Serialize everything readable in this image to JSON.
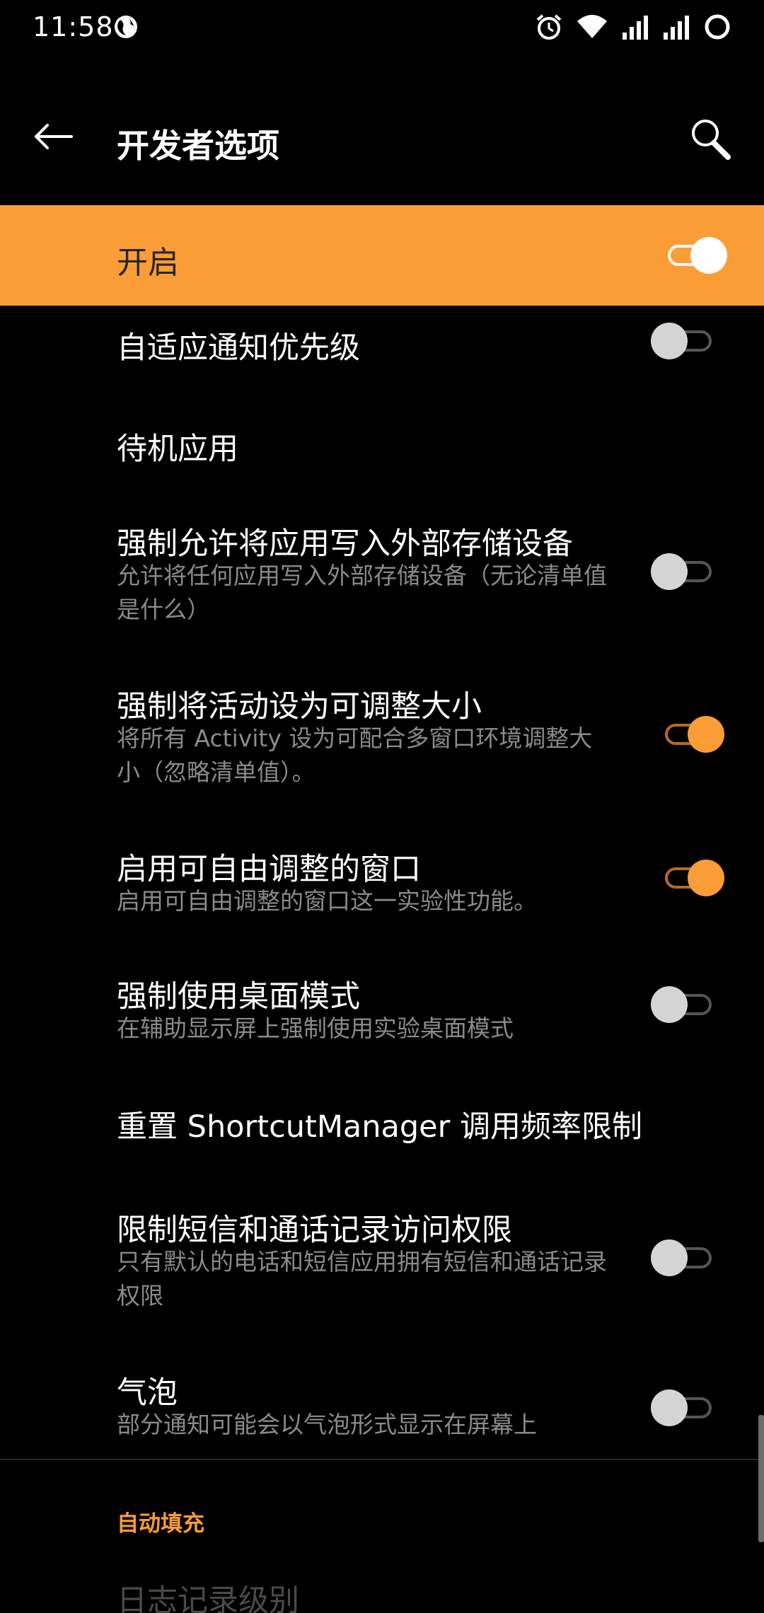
{
  "status_bar": {
    "time": "11:58",
    "icons": [
      "globe-icon",
      "alarm-icon",
      "wifi-icon",
      "signal-icon",
      "signal-icon",
      "battery-ring-icon"
    ]
  },
  "app_bar": {
    "title": "开发者选项",
    "back_icon": "arrow-left-icon",
    "search_icon": "search-icon"
  },
  "master": {
    "label": "开启",
    "state": "on"
  },
  "items": [
    {
      "title": "自适应通知优先级",
      "subtitle": "",
      "toggle": "off"
    },
    {
      "title": "待机应用",
      "subtitle": "",
      "toggle": "none"
    },
    {
      "title": "强制允许将应用写入外部存储设备",
      "subtitle": "允许将任何应用写入外部存储设备（无论清单值是什么）",
      "toggle": "off"
    },
    {
      "title": "强制将活动设为可调整大小",
      "subtitle": "将所有 Activity 设为可配合多窗口环境调整大小（忽略清单值）。",
      "toggle": "on"
    },
    {
      "title": "启用可自由调整的窗口",
      "subtitle": "启用可自由调整的窗口这一实验性功能。",
      "toggle": "on"
    },
    {
      "title": "强制使用桌面模式",
      "subtitle": "在辅助显示屏上强制使用实验桌面模式",
      "toggle": "off"
    },
    {
      "title": "重置 ShortcutManager 调用频率限制",
      "subtitle": "",
      "toggle": "none"
    },
    {
      "title": "限制短信和通话记录访问权限",
      "subtitle": "只有默认的电话和短信应用拥有短信和通话记录权限",
      "toggle": "off"
    },
    {
      "title": "气泡",
      "subtitle": "部分通知可能会以气泡形式显示在屏幕上",
      "toggle": "off"
    }
  ],
  "section": {
    "header": "自动填充",
    "first_item": "日志记录级别"
  },
  "colors": {
    "accent": "#fa9d36",
    "background": "#000000",
    "subtitle": "#8a8a8a"
  }
}
